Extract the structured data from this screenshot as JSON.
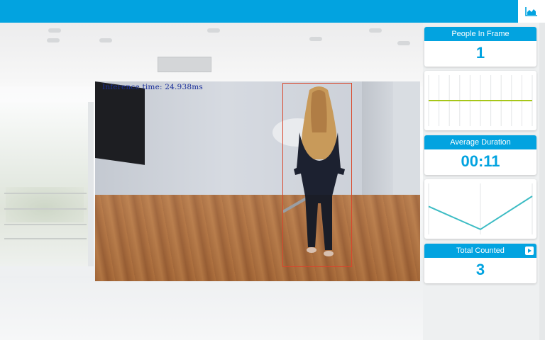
{
  "header": {
    "chart_icon": "area-chart-icon"
  },
  "video": {
    "inference_text": "Inference time: 24.938ms"
  },
  "stats": {
    "people_in_frame": {
      "label": "People In Frame",
      "value": "1"
    },
    "average_duration": {
      "label": "Average Duration",
      "value": "00:11"
    },
    "total_counted": {
      "label": "Total Counted",
      "value": "3",
      "icon": "play-icon"
    }
  },
  "colors": {
    "accent": "#02a3e0",
    "line_green": "#a6c619",
    "line_teal": "#3dbcc4",
    "bbox": "#d9462b"
  },
  "chart_data": [
    {
      "type": "line",
      "series": [
        {
          "values": [
            1,
            1,
            1,
            1,
            1,
            1,
            1,
            1,
            1,
            1,
            1
          ]
        }
      ]
    },
    {
      "type": "line",
      "series": [
        {
          "values": [
            0.55,
            0.1,
            0.75
          ]
        }
      ]
    }
  ]
}
